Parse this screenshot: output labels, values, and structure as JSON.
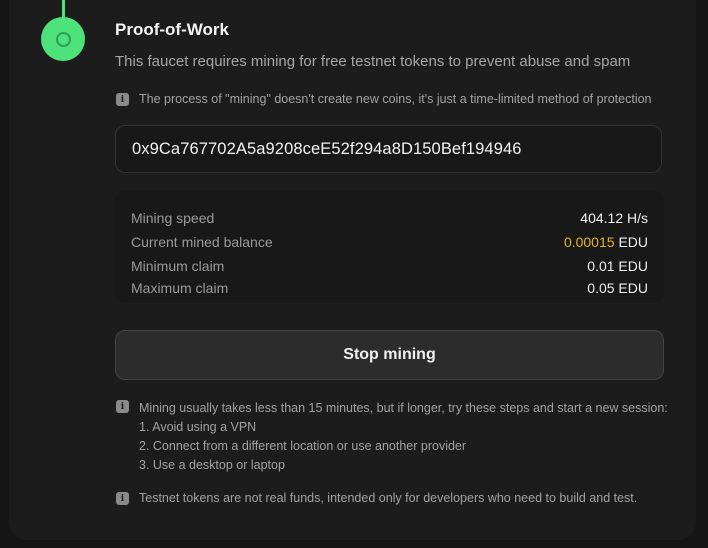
{
  "step": {
    "title": "Proof-of-Work",
    "description": "This faucet requires mining for free testnet tokens to prevent abuse and spam",
    "status_color": "#4ee27a"
  },
  "notes": {
    "icon": "info-icon",
    "mining_explainer": "The process of \"mining\" doesn't create new coins, it's just a time-limited method of protection",
    "tips_intro": "Mining usually takes less than 15 minutes, but if longer, try these steps and start a new session:",
    "tips": [
      "1. Avoid using a VPN",
      "2. Connect from a different location or use another provider",
      "3. Use a desktop or laptop"
    ],
    "disclaimer": "Testnet tokens are not real funds, intended only for developers who need to build and test."
  },
  "wallet": {
    "address": "0x9Ca767702A5a9208ceE52f294a8D150Bef194946"
  },
  "stats": {
    "mining_speed": {
      "label": "Mining speed",
      "value": "404.12 H/s"
    },
    "mined_balance": {
      "label": "Current mined balance",
      "amount": "0.00015",
      "unit": "EDU",
      "accent_color": "#e3b41e"
    },
    "min_claim": {
      "label": "Minimum claim",
      "value": "0.01 EDU"
    },
    "max_claim": {
      "label": "Maximum claim",
      "value": "0.05 EDU"
    }
  },
  "actions": {
    "stop_label": "Stop mining"
  }
}
